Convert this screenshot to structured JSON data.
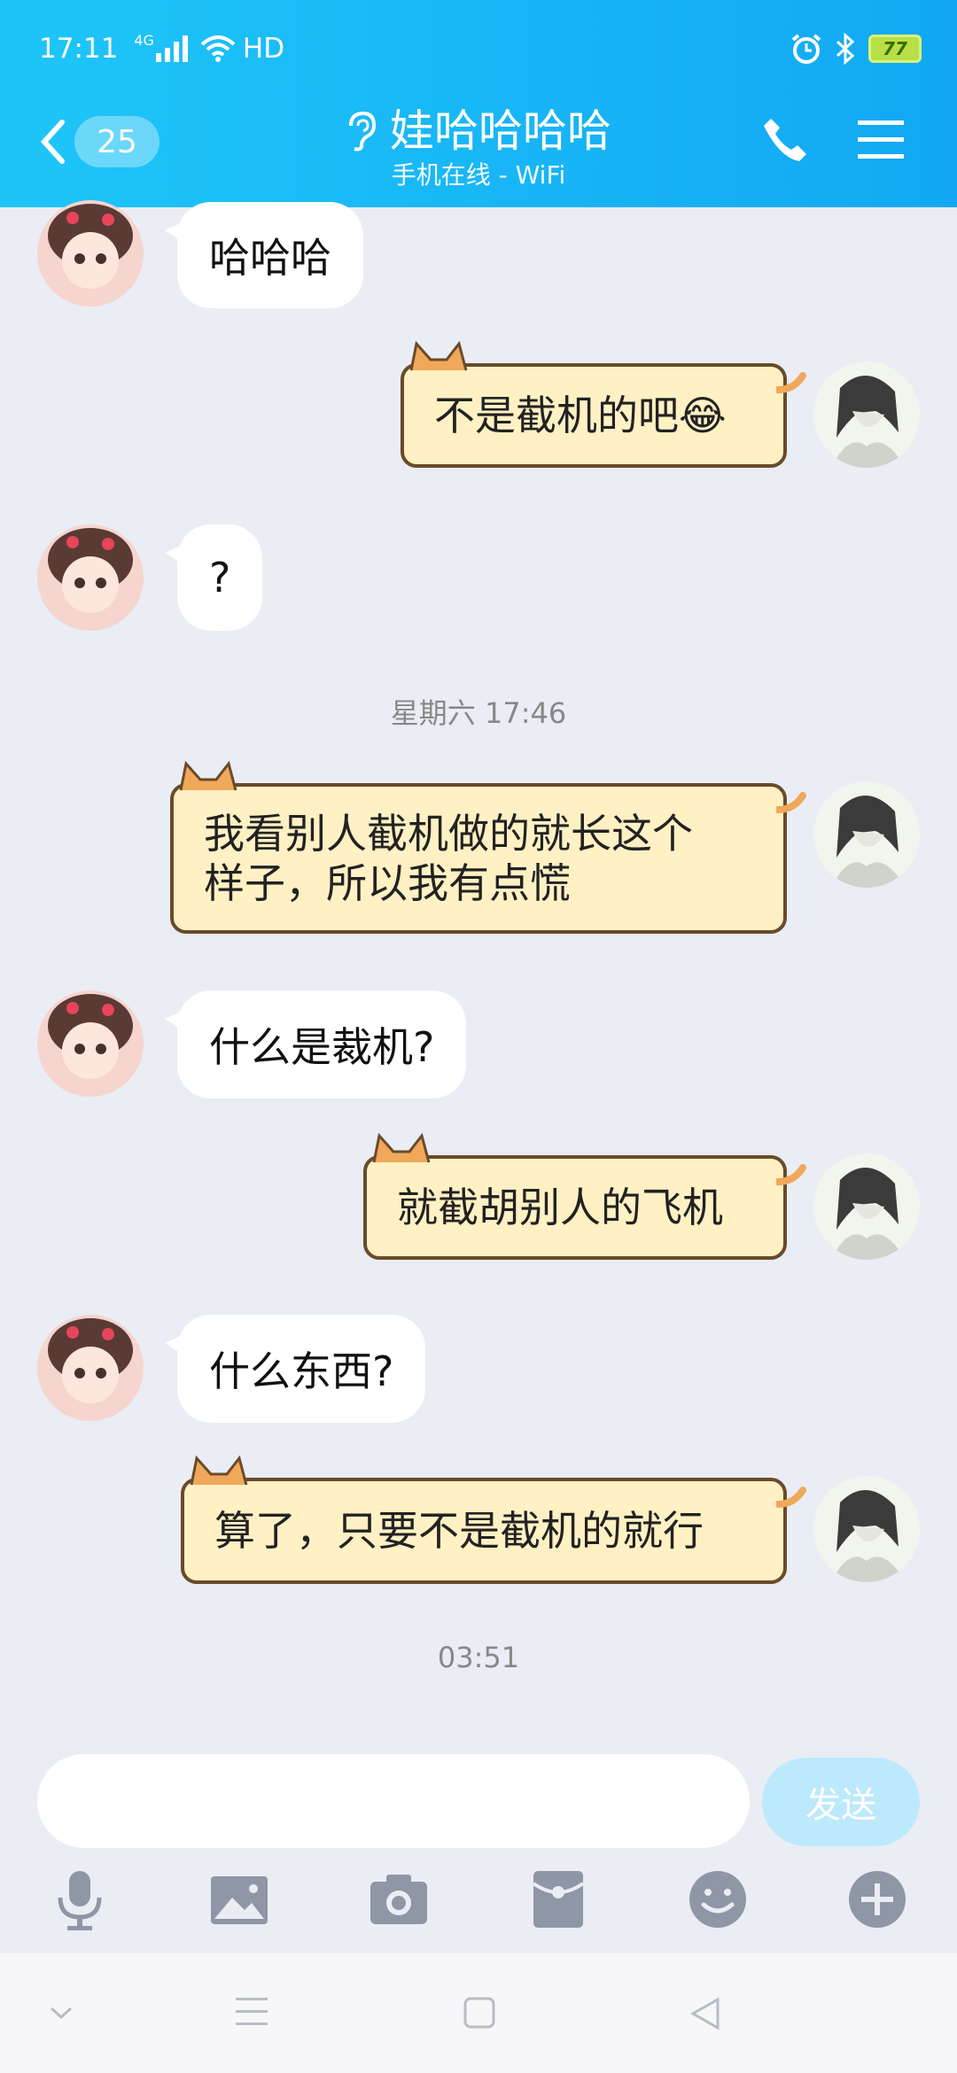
{
  "status_bar": {
    "time": "17:11",
    "network": "4G",
    "hd": "HD",
    "battery": "77"
  },
  "header": {
    "unread_count": "25",
    "title": "娃哈哈哈哈",
    "subtitle": "手机在线 - WiFi"
  },
  "messages": [
    {
      "side": "in",
      "text": "哈哈哈"
    },
    {
      "side": "out",
      "text": "不是截机的吧😂"
    },
    {
      "side": "in",
      "text": "?"
    },
    {
      "side": "time",
      "text": "星期六 17:46"
    },
    {
      "side": "out",
      "text": "我看别人截机做的就长这个样子，所以我有点慌",
      "line1": "我看别人截机做的就长这个",
      "line2": "样子，所以我有点慌"
    },
    {
      "side": "in",
      "text": "什么是裁机?"
    },
    {
      "side": "out",
      "text": "就截胡别人的飞机"
    },
    {
      "side": "in",
      "text": "什么东西?"
    },
    {
      "side": "out",
      "text": "算了，只要不是截机的就行"
    },
    {
      "side": "time",
      "text": "03:51"
    }
  ],
  "input": {
    "value": "",
    "send_label": "发送"
  },
  "toolbar_icons": [
    "microphone-icon",
    "image-icon",
    "camera-icon",
    "red-packet-icon",
    "emoji-icon",
    "plus-icon"
  ],
  "colors": {
    "header": "#12a8f4",
    "out_bubble": "#fff1c4",
    "out_border": "#6b4a2a",
    "in_bubble": "#ffffff",
    "background": "#eaedf4",
    "send_button": "#bde9fc"
  }
}
